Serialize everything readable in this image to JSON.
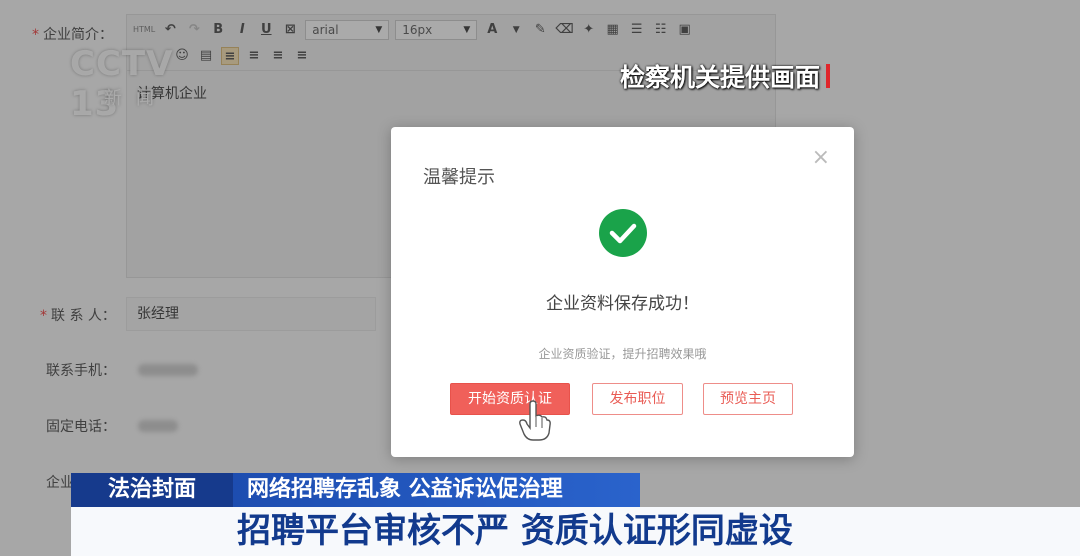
{
  "form": {
    "intro_label": "企业简介：",
    "toolbar": {
      "html_label": "HTML",
      "bold": "B",
      "italic": "I",
      "underline": "U",
      "font_family": "arial",
      "font_size": "16px",
      "font_color": "A"
    },
    "editor_text": "计算机企业",
    "contact_label": "联 系 人：",
    "contact_value": "张经理",
    "mobile_label": "联系手机：",
    "phone_label": "固定电话：",
    "partial_label": "企业"
  },
  "watermark": {
    "logo": "CCTV 13",
    "logo_sub": "新闻",
    "source_caption": "检察机关提供画面"
  },
  "modal": {
    "title": "温馨提示",
    "close": "×",
    "success_message": "企业资料保存成功！",
    "hint": "企业资质验证，提升招聘效果哦",
    "buttons": {
      "verify": "开始资质认证",
      "post_job": "发布职位",
      "preview": "预览主页"
    },
    "success_color": "#1aa34a",
    "primary_color": "#f0605a"
  },
  "ticker": {
    "program": "法治封面",
    "line1": "网络招聘存乱象 公益诉讼促治理",
    "line2": "招聘平台审核不严 资质认证形同虚设"
  }
}
